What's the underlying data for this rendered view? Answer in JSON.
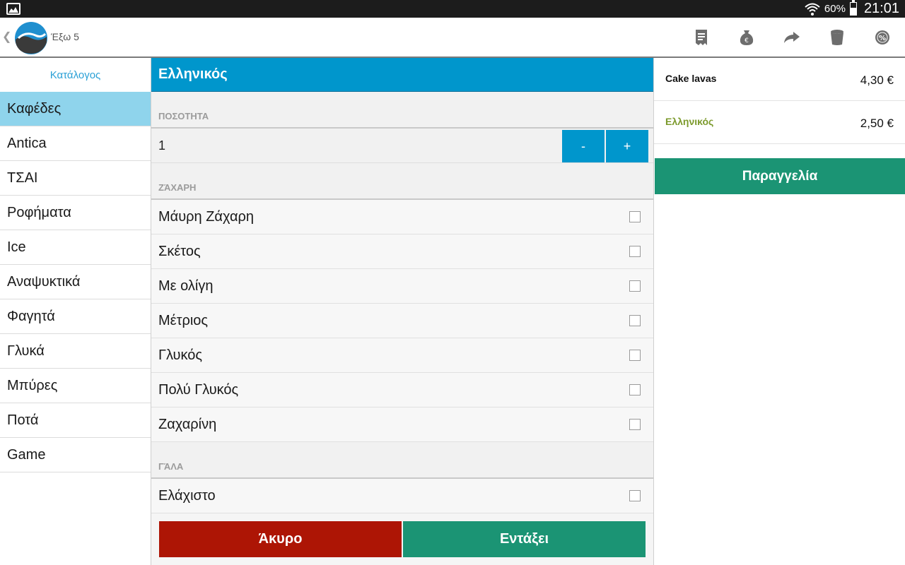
{
  "status_bar": {
    "battery_percent": "60%",
    "battery_level": 0.6,
    "time": "21:01"
  },
  "action_bar": {
    "title": "Έξω 5",
    "icons": [
      "receipt-icon",
      "money-bag-icon",
      "forward-icon",
      "trash-bin-icon",
      "discount-icon"
    ]
  },
  "sidebar": {
    "header": "Κατάλογος",
    "items": [
      {
        "label": "Καφέδες",
        "active": true
      },
      {
        "label": "Antica"
      },
      {
        "label": "ΤΣΑΙ"
      },
      {
        "label": "Ροφήματα"
      },
      {
        "label": "Ice"
      },
      {
        "label": "Αναψυκτικά"
      },
      {
        "label": "Φαγητά"
      },
      {
        "label": "Γλυκά"
      },
      {
        "label": "Μπύρες"
      },
      {
        "label": "Ποτά"
      },
      {
        "label": "Game"
      }
    ]
  },
  "product": {
    "title": "Ελληνικός",
    "quantity_label": "ΠΟΣΟΤΗΤΑ",
    "quantity": "1",
    "minus_label": "-",
    "plus_label": "+",
    "sugar_label": "ΖΆΧΑΡΗ",
    "sugar_options": [
      "Μάυρη Ζάχαρη",
      "Σκέτος",
      "Με ολίγη",
      "Μέτριος",
      "Γλυκός",
      "Πολύ Γλυκός",
      "Ζαχαρίνη"
    ],
    "milk_label": "ΓΆΛΑ",
    "milk_options": [
      "Ελάχιστο"
    ],
    "cancel_label": "Άκυρο",
    "ok_label": "Εντάξει"
  },
  "order": {
    "lines": [
      {
        "name": "Cake lavas",
        "price": "4,30 €"
      },
      {
        "name": "Ελληνικός",
        "price": "2,50 €"
      }
    ],
    "order_button": "Παραγγελία"
  },
  "colors": {
    "primary": "#0096cc",
    "active_category": "#8fd4ec",
    "cancel": "#ad1505",
    "confirm": "#1b9474",
    "pending_item": "#7c9a2c"
  }
}
